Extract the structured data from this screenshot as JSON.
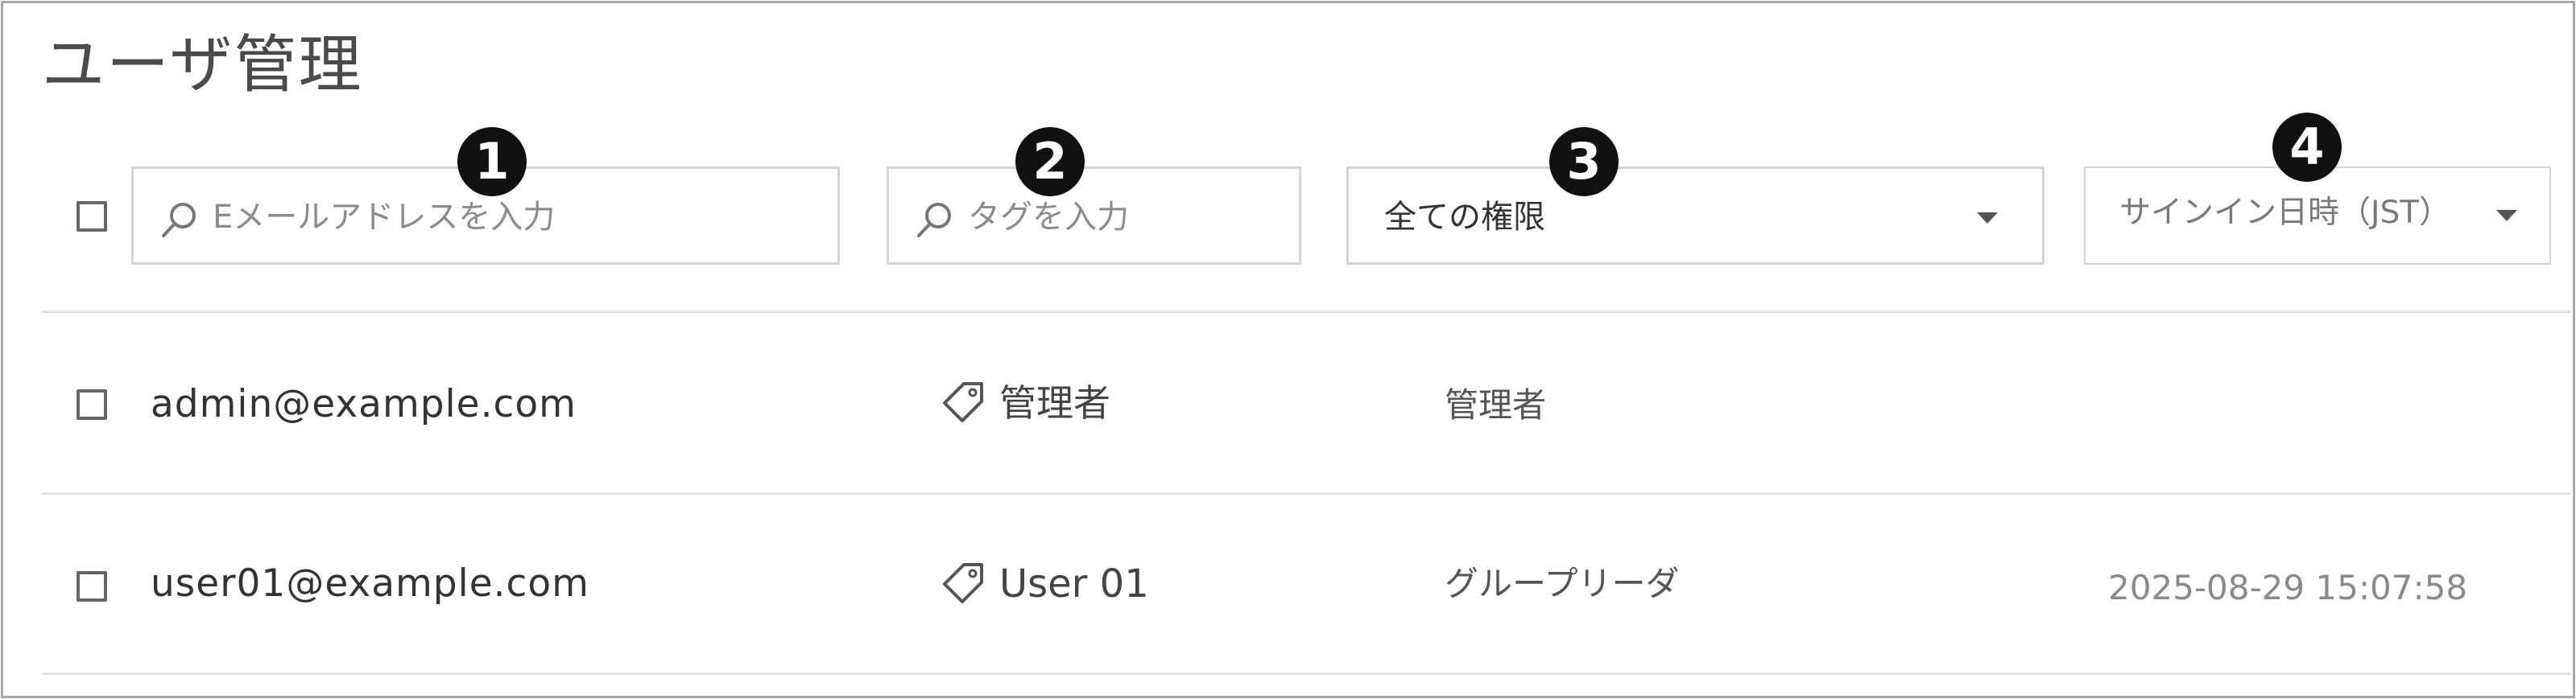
{
  "page": {
    "title": "ユーザ管理"
  },
  "filters": {
    "email_search": {
      "placeholder": "Eメールアドレスを入力",
      "icon": "search-icon"
    },
    "tag_search": {
      "placeholder": "タグを入力",
      "icon": "search-icon"
    },
    "permission_select": {
      "value": "全ての権限",
      "icon": "chevron-down-icon"
    },
    "signin_sort": {
      "value": "サインイン日時（JST）",
      "icon": "chevron-down-icon"
    }
  },
  "markers": [
    "1",
    "2",
    "3",
    "4"
  ],
  "users": [
    {
      "email": "admin@example.com",
      "tag": "管理者",
      "role": "管理者",
      "signin": ""
    },
    {
      "email": "user01@example.com",
      "tag": "User 01",
      "role": "グループリーダ",
      "signin": "2025-08-29 15:07:58"
    }
  ],
  "colors": {
    "border": "#a9a9a9",
    "field_border": "#d4d4d4",
    "divider": "#e2e2e2",
    "marker_bg": "#111111"
  }
}
